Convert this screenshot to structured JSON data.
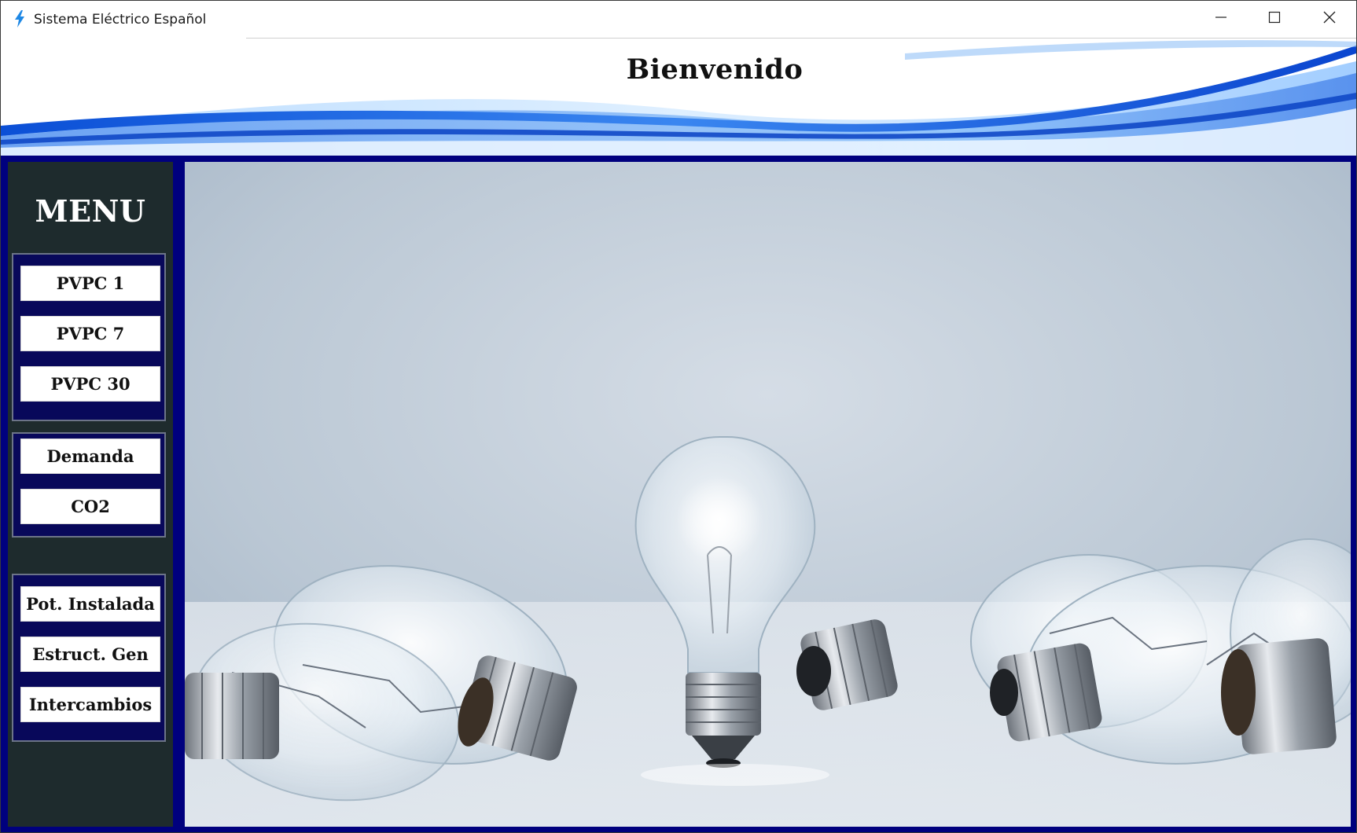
{
  "window": {
    "title": "Sistema Eléctrico Español",
    "app_icon": "lightning-bolt-icon",
    "controls": [
      "minimize-icon",
      "maximize-icon",
      "close-icon"
    ]
  },
  "header": {
    "title": "Bienvenido"
  },
  "sidebar": {
    "title": "MENU",
    "groups": [
      {
        "buttons": [
          {
            "label": "PVPC 1"
          },
          {
            "label": "PVPC 7"
          },
          {
            "label": "PVPC 30"
          }
        ]
      },
      {
        "buttons": [
          {
            "label": "Demanda"
          },
          {
            "label": "CO2"
          }
        ]
      },
      {
        "buttons": [
          {
            "label": "Pot. Instalada"
          },
          {
            "label": "Estruct. Gen"
          },
          {
            "label": "Intercambios"
          }
        ]
      }
    ]
  },
  "main": {
    "image": "light-bulbs-photo"
  },
  "colors": {
    "frame": "#00007e",
    "sidebar_bg": "#1e2b2d",
    "group_bg": "#08085a",
    "accent": "#1e88e5"
  }
}
